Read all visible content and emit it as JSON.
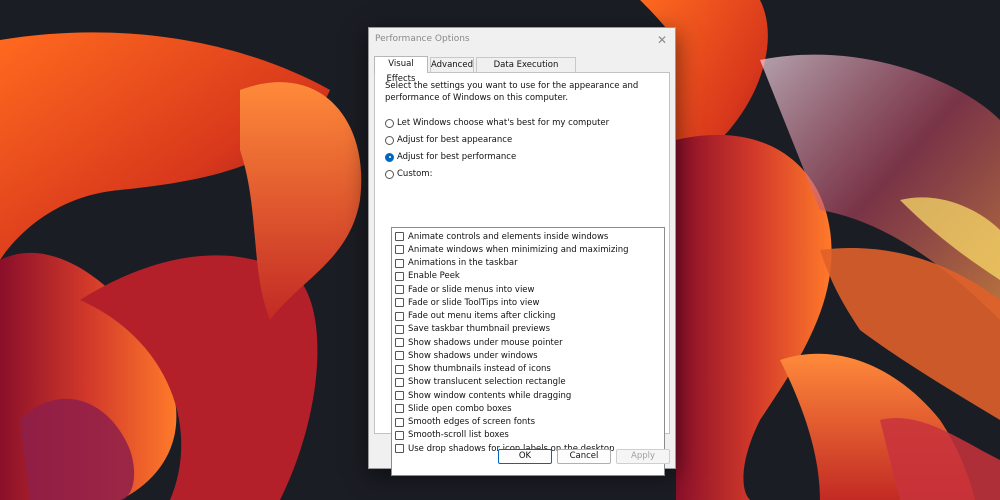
{
  "dialog": {
    "title": "Performance Options",
    "close_symbol": "✕",
    "tabs": [
      {
        "label": "Visual Effects",
        "active": true
      },
      {
        "label": "Advanced",
        "active": false
      },
      {
        "label": "Data Execution Prevention",
        "active": false
      }
    ],
    "description": "Select the settings you want to use for the appearance and performance of Windows on this computer.",
    "radios": [
      {
        "label": "Let Windows choose what's best for my computer",
        "checked": false
      },
      {
        "label": "Adjust for best appearance",
        "checked": false
      },
      {
        "label": "Adjust for best performance",
        "checked": true
      },
      {
        "label": "Custom:",
        "checked": false
      }
    ],
    "options": [
      {
        "label": "Animate controls and elements inside windows",
        "checked": false
      },
      {
        "label": "Animate windows when minimizing and maximizing",
        "checked": false
      },
      {
        "label": "Animations in the taskbar",
        "checked": false
      },
      {
        "label": "Enable Peek",
        "checked": false
      },
      {
        "label": "Fade or slide menus into view",
        "checked": false
      },
      {
        "label": "Fade or slide ToolTips into view",
        "checked": false
      },
      {
        "label": "Fade out menu items after clicking",
        "checked": false
      },
      {
        "label": "Save taskbar thumbnail previews",
        "checked": false
      },
      {
        "label": "Show shadows under mouse pointer",
        "checked": false
      },
      {
        "label": "Show shadows under windows",
        "checked": false
      },
      {
        "label": "Show thumbnails instead of icons",
        "checked": false
      },
      {
        "label": "Show translucent selection rectangle",
        "checked": false
      },
      {
        "label": "Show window contents while dragging",
        "checked": false
      },
      {
        "label": "Slide open combo boxes",
        "checked": false
      },
      {
        "label": "Smooth edges of screen fonts",
        "checked": false
      },
      {
        "label": "Smooth-scroll list boxes",
        "checked": false
      },
      {
        "label": "Use drop shadows for icon labels on the desktop",
        "checked": false
      }
    ],
    "buttons": {
      "ok": "OK",
      "cancel": "Cancel",
      "apply": "Apply"
    }
  },
  "colors": {
    "accent": "#0067c0",
    "wallpaper_bg": "#1b1d24",
    "wallpaper_orange": "#e8531c",
    "wallpaper_red": "#b41c2e"
  }
}
